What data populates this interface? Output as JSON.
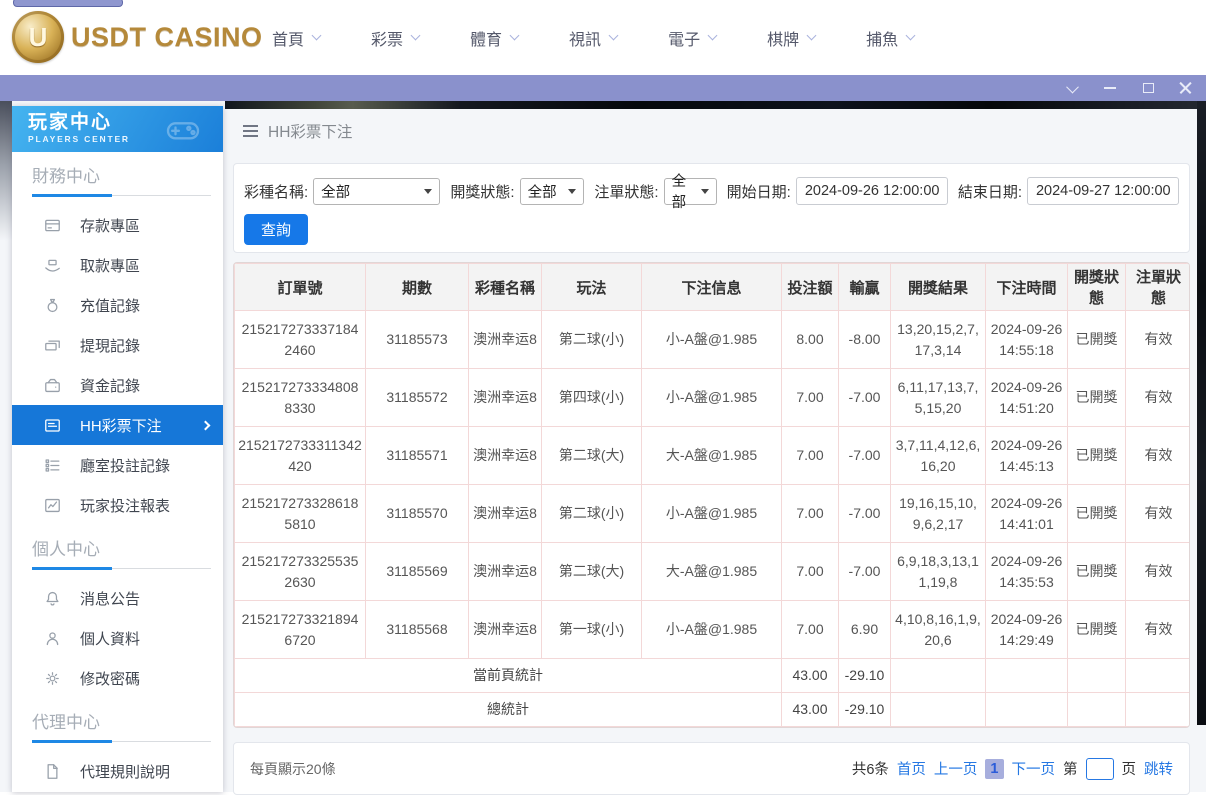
{
  "top_nav": {
    "logo_text": "USDT CASINO",
    "items": [
      "首頁",
      "彩票",
      "體育",
      "視訊",
      "電子",
      "棋牌",
      "捕魚"
    ]
  },
  "window_controls": [
    "chevron-down",
    "minimize",
    "maximize",
    "close"
  ],
  "sidebar": {
    "title": "玩家中心",
    "subtitle": "PLAYERS CENTER",
    "sections": [
      {
        "label": "財務中心",
        "items": [
          {
            "icon": "deposit-card-icon",
            "label": "存款專區"
          },
          {
            "icon": "withdraw-hand-icon",
            "label": "取款專區"
          },
          {
            "icon": "moneybag-icon",
            "label": "充值記錄"
          },
          {
            "icon": "banknotes-icon",
            "label": "提現記錄"
          },
          {
            "icon": "purse-icon",
            "label": "資金記錄"
          },
          {
            "icon": "lottery-list-icon",
            "label": "HH彩票下注",
            "active": true
          },
          {
            "icon": "checklist-icon",
            "label": "廳室投註記錄"
          },
          {
            "icon": "report-chart-icon",
            "label": "玩家投注報表"
          }
        ]
      },
      {
        "label": "個人中心",
        "items": [
          {
            "icon": "bell-icon",
            "label": "消息公告"
          },
          {
            "icon": "person-icon",
            "label": "個人資料"
          },
          {
            "icon": "gear-icon",
            "label": "修改密碼"
          }
        ]
      },
      {
        "label": "代理中心",
        "items": [
          {
            "icon": "document-icon",
            "label": "代理規則說明"
          }
        ]
      }
    ]
  },
  "main": {
    "breadcrumb": "HH彩票下注",
    "filters": {
      "lottery_label": "彩種名稱:",
      "lottery_value": "全部",
      "draw_status_label": "開獎狀態:",
      "draw_status_value": "全部",
      "order_status_label": "注單狀態:",
      "order_status_value": "全部",
      "start_label": "開始日期:",
      "start_value": "2024-09-26 12:00:00",
      "end_label": "結束日期:",
      "end_value": "2024-09-27 12:00:00",
      "search_label": "查詢"
    },
    "table": {
      "columns": [
        "訂單號",
        "期數",
        "彩種名稱",
        "玩法",
        "下注信息",
        "投注額",
        "輸贏",
        "開獎結果",
        "下注時間",
        "開獎狀態",
        "注單狀態"
      ],
      "rows": [
        [
          "2152172733371842460",
          "31185573",
          "澳洲幸运8",
          "第二球(小)",
          "小-A盤@1.985",
          "8.00",
          "-8.00",
          "13,20,15,2,7,17,3,14",
          "2024-09-26 14:55:18",
          "已開獎",
          "有效"
        ],
        [
          "2152172733348088330",
          "31185572",
          "澳洲幸运8",
          "第四球(小)",
          "小-A盤@1.985",
          "7.00",
          "-7.00",
          "6,11,17,13,7,5,15,20",
          "2024-09-26 14:51:20",
          "已開獎",
          "有效"
        ],
        [
          "2152172733311342420",
          "31185571",
          "澳洲幸运8",
          "第二球(大)",
          "大-A盤@1.985",
          "7.00",
          "-7.00",
          "3,7,11,4,12,6,16,20",
          "2024-09-26 14:45:13",
          "已開獎",
          "有效"
        ],
        [
          "2152172733286185810",
          "31185570",
          "澳洲幸运8",
          "第二球(小)",
          "小-A盤@1.985",
          "7.00",
          "-7.00",
          "19,16,15,10,9,6,2,17",
          "2024-09-26 14:41:01",
          "已開獎",
          "有效"
        ],
        [
          "2152172733255352630",
          "31185569",
          "澳洲幸运8",
          "第二球(大)",
          "大-A盤@1.985",
          "7.00",
          "-7.00",
          "6,9,18,3,13,11,19,8",
          "2024-09-26 14:35:53",
          "已開獎",
          "有效"
        ],
        [
          "2152172733218946720",
          "31185568",
          "澳洲幸运8",
          "第一球(小)",
          "小-A盤@1.985",
          "7.00",
          "6.90",
          "4,10,8,16,1,9,20,6",
          "2024-09-26 14:29:49",
          "已開獎",
          "有效"
        ]
      ],
      "summary_rows": [
        {
          "label": "當前頁統計",
          "bet": "43.00",
          "win": "-29.10"
        },
        {
          "label": "總統計",
          "bet": "43.00",
          "win": "-29.10"
        }
      ]
    },
    "footer": {
      "page_size_text": "每頁顯示20條",
      "total_text": "共6条",
      "first_label": "首页",
      "prev_label": "上一页",
      "current_page": "1",
      "next_label": "下一页",
      "jump_prefix": "第",
      "jump_suffix": "页",
      "jump_label": "跳转"
    }
  },
  "colors": {
    "titlebar_purple": "#8a91cc",
    "accent_blue": "#1677d8",
    "link_blue": "#2678e3",
    "gold": "#b5893a",
    "table_border_pink": "#f3d8d8"
  }
}
